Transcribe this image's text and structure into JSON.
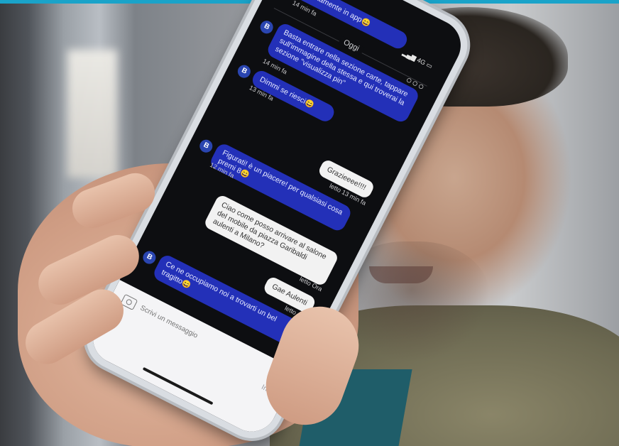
{
  "chat": {
    "header": {
      "day": "Oggi",
      "network": "4G"
    },
    "messages": [
      {
        "from": "agent",
        "avatar": "B",
        "text": "direttamente in app😄",
        "time": "14 min fa"
      },
      {
        "from": "agent",
        "avatar": "B",
        "text": "Basta entrare nella sezione carte, tappare sull'immagine della stessa e qui troverai la sezione \"visualizza pin\"",
        "time": "14 min fa"
      },
      {
        "from": "agent",
        "avatar": "B",
        "text": "Dimmi se riesci😄",
        "time": "13 min fa"
      },
      {
        "from": "user",
        "text": "Grazieeee!!!!",
        "time": "letto 13 min fa"
      },
      {
        "from": "agent",
        "avatar": "B",
        "text": "Figurati! è un piacere! per qualsiasi cosa premi 8😄",
        "time": "12 min fa"
      },
      {
        "from": "user",
        "text": "Ciao come posso arrivare al salone del mobile da piazza Garibaldi aulenti a Milano?",
        "time": "letto Ora"
      },
      {
        "from": "user",
        "text": "Gae Aulenti",
        "time": "letto Ora"
      },
      {
        "from": "agent",
        "avatar": "B",
        "text": "Ce ne occupiamo noi a trovarti un bel tragitto😄",
        "time": ""
      }
    ],
    "composer": {
      "placeholder": "Scrivi un messaggio",
      "send_label": "Invia"
    }
  },
  "icons": {
    "close": "close-icon",
    "more": "more-icon",
    "camera": "camera-icon",
    "scroll_down": "arrow-down-icon"
  },
  "colors": {
    "accent_bar": "#1aa3c9",
    "agent_bubble": "#2330b8",
    "user_bubble": "#f2f2f2",
    "screen_bg": "#0d0e11"
  }
}
